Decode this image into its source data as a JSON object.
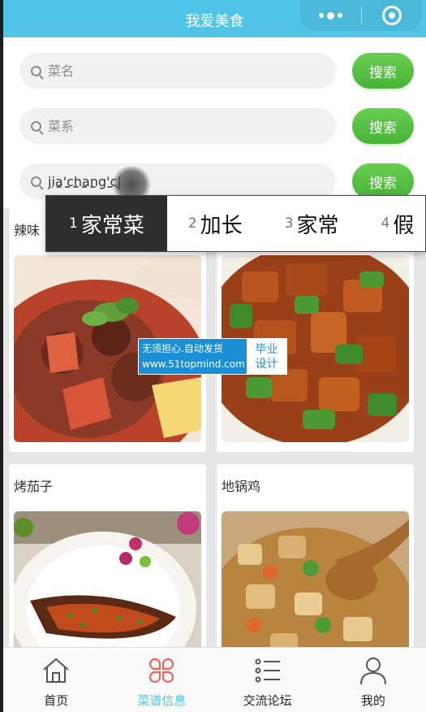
{
  "header": {
    "title": "我爱美食"
  },
  "search_rows": [
    {
      "placeholder": "菜名",
      "value": "",
      "button": "搜索"
    },
    {
      "placeholder": "菜系",
      "value": "",
      "button": "搜索"
    },
    {
      "placeholder": "",
      "value": "jia'chang'c|",
      "button": "搜索"
    }
  ],
  "ime": {
    "candidates": [
      {
        "num": "1",
        "text": "家常菜",
        "selected": true
      },
      {
        "num": "2",
        "text": "加长",
        "selected": false
      },
      {
        "num": "3",
        "text": "家常",
        "selected": false
      },
      {
        "num": "4",
        "text": "假",
        "selected": false
      }
    ]
  },
  "dishes": [
    {
      "title": "辣味",
      "image": "beef-stew-photo"
    },
    {
      "title": "",
      "image": "braised-pork-peppers-photo"
    },
    {
      "title": "烤茄子",
      "image": "grilled-eggplant-photo"
    },
    {
      "title": "地锅鸡",
      "image": "chicken-vegetables-photo"
    }
  ],
  "watermark": {
    "line1": "无须担心.自动发货",
    "line2": "www.51topmind.com",
    "right1": "毕业",
    "right2": "设计"
  },
  "tabs": [
    {
      "label": "首页",
      "icon": "home-icon",
      "active": false
    },
    {
      "label": "菜谱信息",
      "icon": "recipe-grid-icon",
      "active": true
    },
    {
      "label": "交流论坛",
      "icon": "forum-list-icon",
      "active": false
    },
    {
      "label": "我的",
      "icon": "profile-icon",
      "active": false
    }
  ],
  "colors": {
    "accent": "#4fc4e6",
    "button_green": "#52be40",
    "active_tab": "#e8655a"
  }
}
